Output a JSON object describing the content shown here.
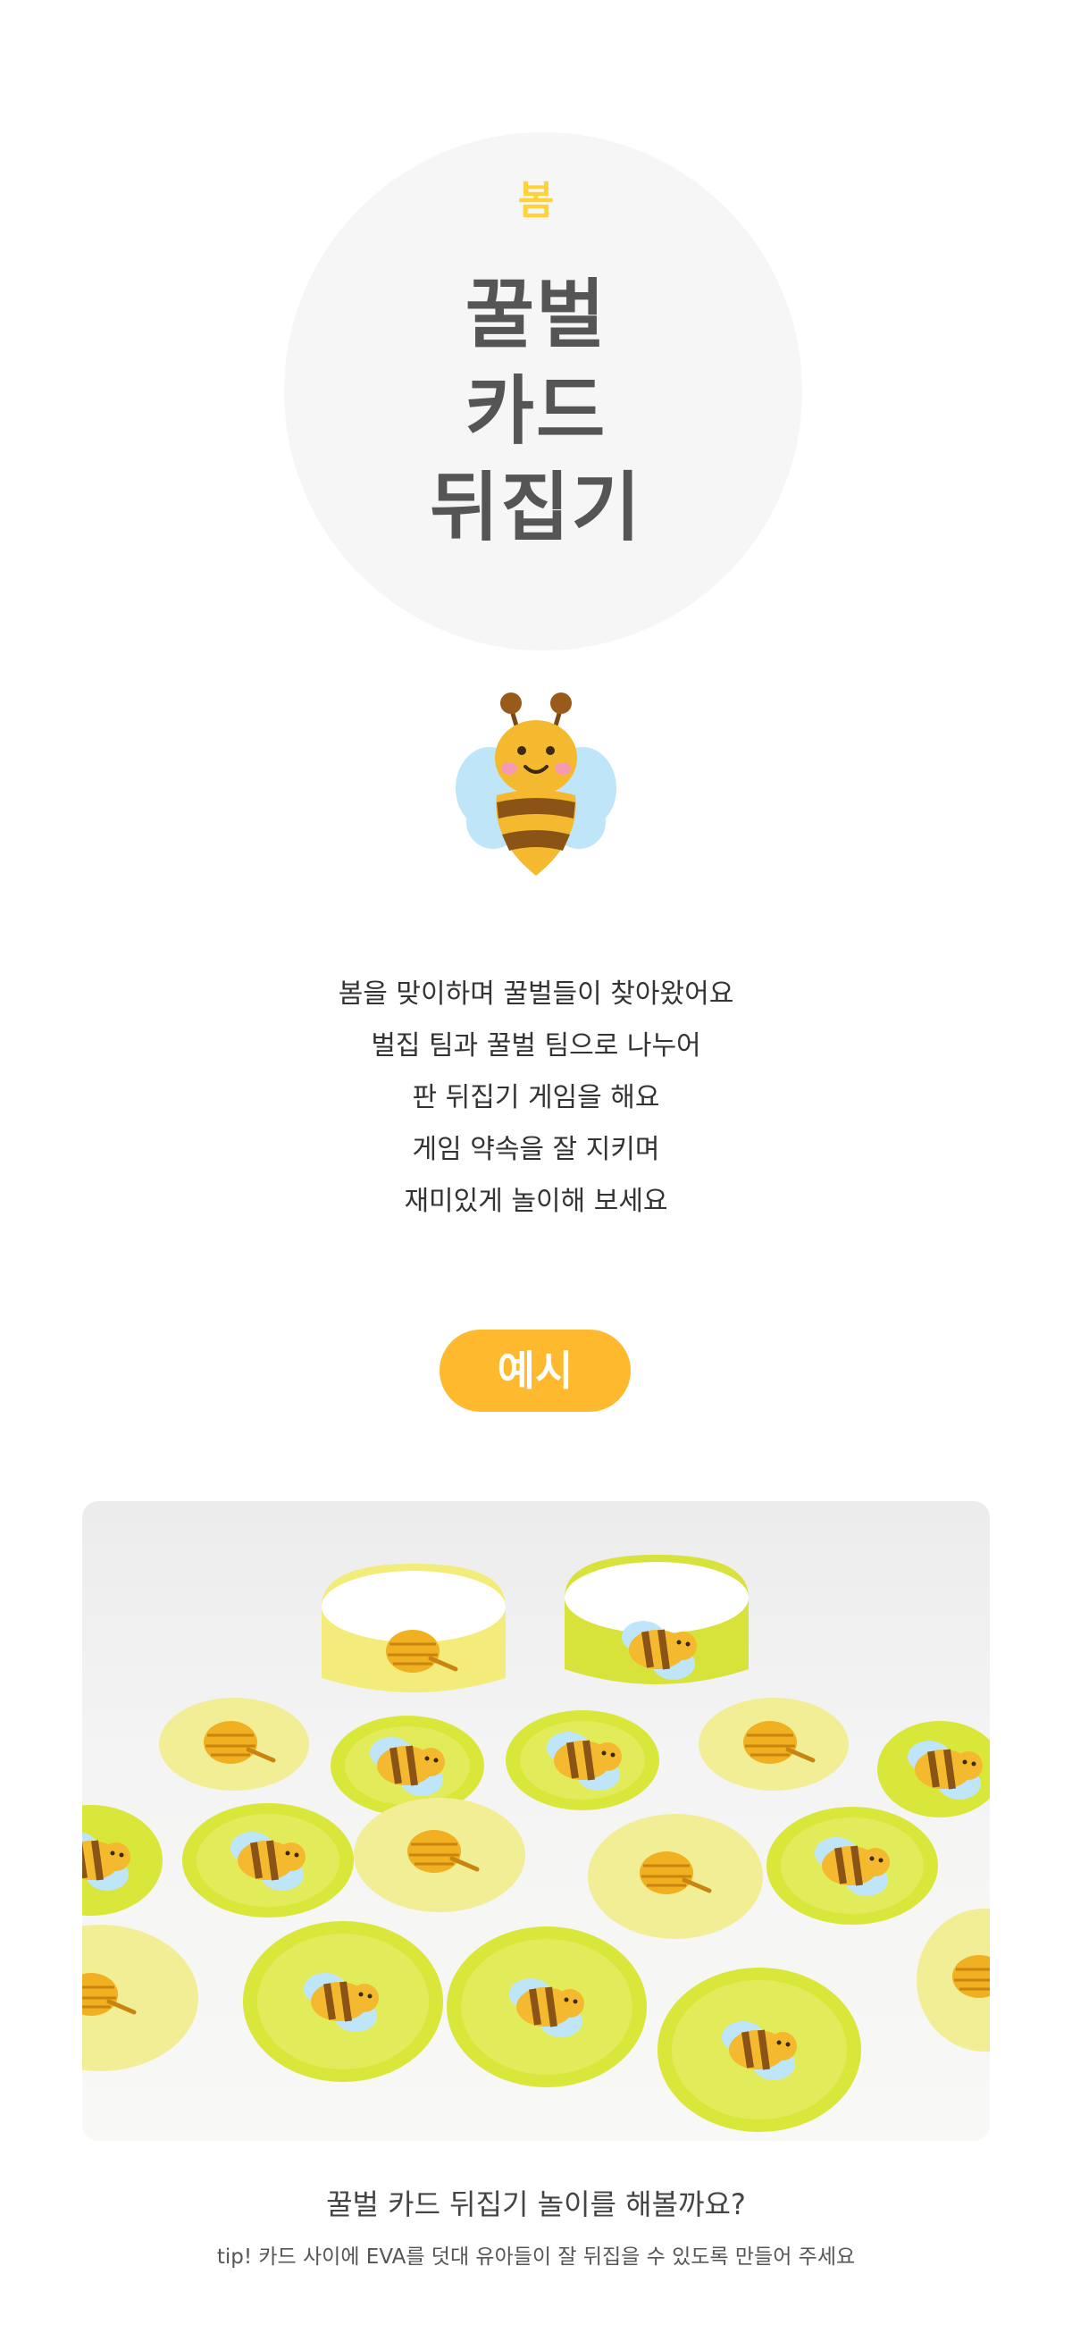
{
  "header": {
    "season": "봄",
    "title_lines": [
      "꿀벌",
      "카드",
      "뒤집기"
    ]
  },
  "description": {
    "lines": [
      "봄을 맞이하며 꿀벌들이 찾아왔어요",
      "벌집 팀과 꿀벌 팀으로 나누어",
      "판 뒤집기 게임을 해요",
      "게임 약속을 잘 지키며",
      "재미있게 놀이해 보세요"
    ]
  },
  "example_button": {
    "label": "예시"
  },
  "caption": {
    "main": "꿀벌 카드 뒤집기 놀이를 해볼까요?",
    "tip": "tip! 카드 사이에 EVA를 덧대 유아들이 잘 뒤집을 수 있도록 만들어 주세요"
  },
  "colors": {
    "accent": "#ffb92e",
    "season": "#ffd23a",
    "title": "#555555",
    "card_green": "#d9e63a",
    "card_yellow": "#f3ef8a"
  },
  "icons": [
    "bee-illustration",
    "honeycomb-card-icon",
    "bee-card-icon"
  ]
}
